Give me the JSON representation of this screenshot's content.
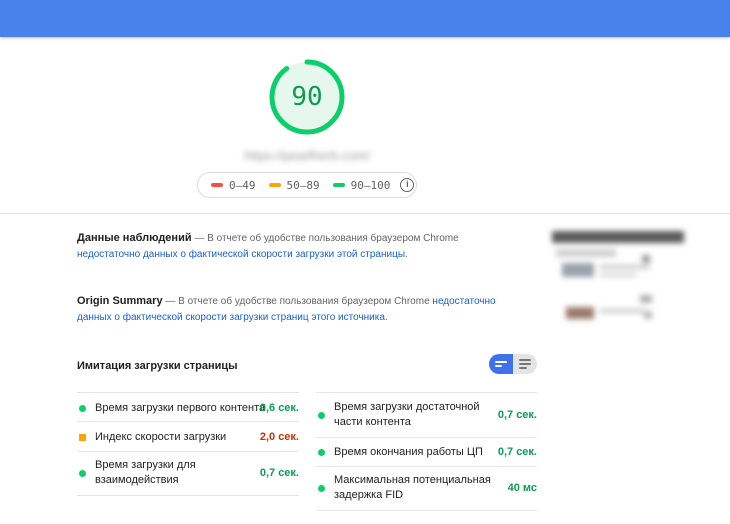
{
  "score": {
    "value": "90",
    "fraction": 0.9,
    "color": "#0cce6b"
  },
  "url": "https://pearlherb.com/",
  "legend": {
    "fail": {
      "label": "0–49",
      "color": "#ff4e42"
    },
    "average": {
      "label": "50–89",
      "color": "#ffa400"
    },
    "pass": {
      "label": "90–100",
      "color": "#0cce6b"
    },
    "info_icon": "info-icon"
  },
  "field_data": {
    "title": "Данные наблюдений",
    "dash": " — ",
    "text": "В отчете об удобстве пользования браузером Chrome ",
    "link": "недостаточно данных о фактической скорости загрузки этой страницы",
    "end": "."
  },
  "origin_summary": {
    "title": "Origin Summary",
    "dash": " — ",
    "text": "В отчете об удобстве пользования браузером Chrome ",
    "link": "недостаточно данных о фактической скорости загрузки страниц этого источника",
    "end": "."
  },
  "lab_data": {
    "title": "Имитация загрузки страницы",
    "toggle": {
      "compact_icon": "bars-icon",
      "expanded_icon": "list-icon",
      "active": "compact"
    },
    "metrics_left": [
      {
        "label": "Время загрузки первого контента",
        "value": "0,6 сек.",
        "status": "pass"
      },
      {
        "label": "Индекс скорости загрузки",
        "value": "2,0 сек.",
        "status": "average"
      },
      {
        "label": "Время загрузки для взаимодействия",
        "value": "0,7 сек.",
        "status": "pass"
      }
    ],
    "metrics_right": [
      {
        "label": "Время загрузки достаточной части контента",
        "value": "0,7 сек.",
        "status": "pass"
      },
      {
        "label": "Время окончания работы ЦП",
        "value": "0,7 сек.",
        "status": "pass"
      },
      {
        "label": "Максимальная потенциальная задержка FID",
        "value": "40 мс",
        "status": "pass"
      }
    ]
  },
  "colors": {
    "header": "#4a82ec",
    "pass": "#0cce6b",
    "pass_text": "#0c9d52",
    "average": "#ffa400",
    "average_text": "#c33300",
    "fail": "#ff4e42",
    "link": "#1a5fd0"
  }
}
